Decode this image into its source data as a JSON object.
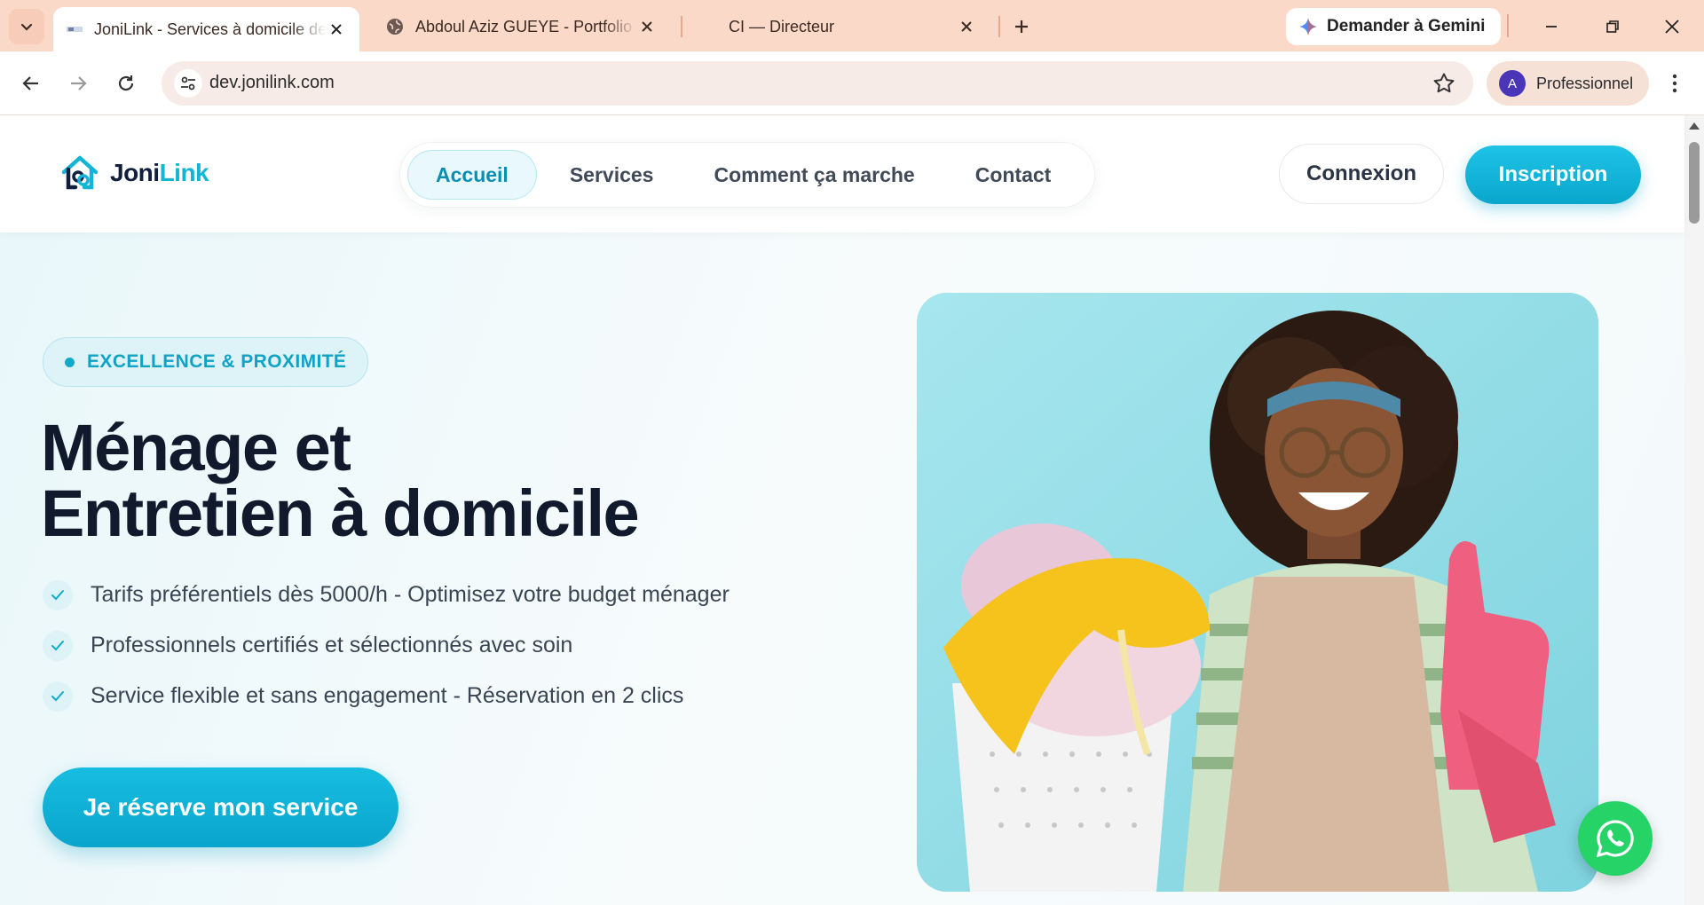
{
  "browser": {
    "tabs": [
      {
        "title": "JoniLink - Services à domicile de",
        "active": true
      },
      {
        "title": "Abdoul Aziz GUEYE - Portfolio P",
        "active": false
      },
      {
        "title": "CI — Directeur",
        "active": false
      }
    ],
    "gemini_label": "Demander à Gemini",
    "url": "dev.jonilink.com",
    "profile": {
      "initial": "A",
      "label": "Professionnel"
    }
  },
  "site": {
    "logo": {
      "part1": "Joni",
      "part2": "Link"
    },
    "nav": [
      {
        "label": "Accueil",
        "active": true
      },
      {
        "label": "Services",
        "active": false
      },
      {
        "label": "Comment ça marche",
        "active": false
      },
      {
        "label": "Contact",
        "active": false
      }
    ],
    "login_label": "Connexion",
    "signup_label": "Inscription"
  },
  "hero": {
    "badge": "EXCELLENCE & PROXIMITÉ",
    "title_line1": "Ménage et",
    "title_line2": "Entretien à domicile",
    "features": [
      "Tarifs préférentiels dès 5000/h - Optimisez votre budget ménager",
      "Professionnels certifiés et sélectionnés avec soin",
      "Service flexible et sans engagement - Réservation en 2 clics"
    ],
    "cta": "Je réserve mon service"
  },
  "colors": {
    "accent": "#12b5d6",
    "tabbar": "#fbd9c9",
    "heading": "#101a2c",
    "whatsapp": "#25d366"
  },
  "icons": [
    "tab-list-icon",
    "site-favicon-icon",
    "globe-icon",
    "close-icon",
    "plus-icon",
    "gemini-sparkle-icon",
    "minimize-icon",
    "restore-icon",
    "back-icon",
    "forward-icon",
    "reload-icon",
    "site-settings-icon",
    "star-icon",
    "kebab-icon",
    "check-icon",
    "whatsapp-icon"
  ]
}
